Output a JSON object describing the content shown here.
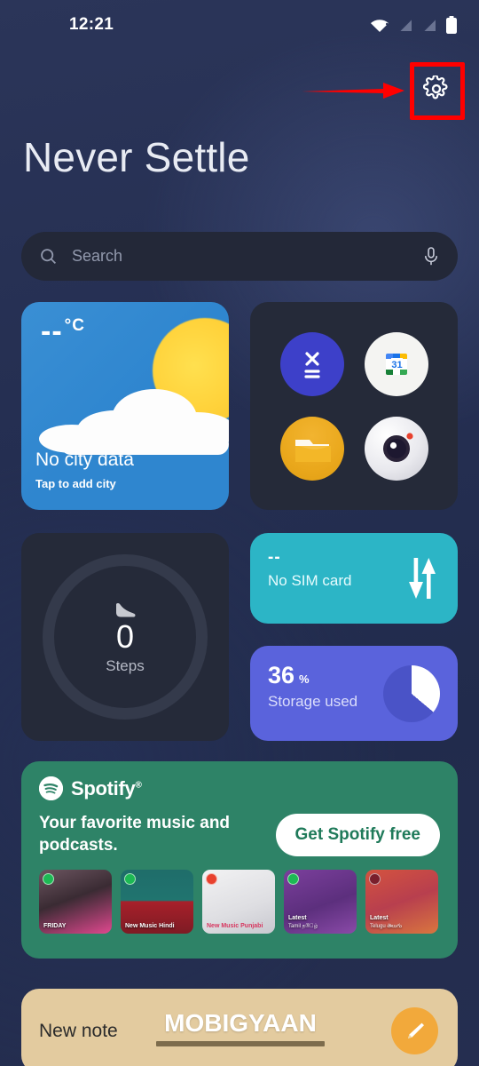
{
  "status_bar": {
    "time": "12:21",
    "icons": [
      "wifi-icon",
      "signal-off-icon",
      "signal-off-icon",
      "battery-icon"
    ]
  },
  "annotation": {
    "highlight_color": "#ff0000",
    "arrow_color": "#ff0000",
    "target": "settings-gear-button"
  },
  "header": {
    "gear_icon": "gear-icon",
    "title": "Never Settle"
  },
  "search": {
    "placeholder": "Search",
    "search_icon": "search-icon",
    "mic_icon": "microphone-icon",
    "background": "#232838"
  },
  "weather_widget": {
    "temperature": "--",
    "unit": "°C",
    "city": "No city data",
    "action": "Tap to add city",
    "background": "#2f86cf"
  },
  "app_folder": {
    "background": "#252a39",
    "apps": [
      {
        "name": "calculator",
        "icon": "calculator-icon",
        "color": "#3d40c9"
      },
      {
        "name": "calendar",
        "icon": "calendar-icon",
        "date": "31",
        "color": "#f4f4f2"
      },
      {
        "name": "files",
        "icon": "folder-icon",
        "color": "#eaa81c"
      },
      {
        "name": "camera",
        "icon": "camera-icon",
        "color": "#e9e9ee"
      }
    ]
  },
  "steps_widget": {
    "icon": "shoe-icon",
    "count": "0",
    "label": "Steps",
    "background": "#252a39",
    "ring_color": "#343a4b"
  },
  "sim_widget": {
    "value": "--",
    "label": "No SIM card",
    "icon": "data-transfer-icon",
    "background": "#2cb5c6"
  },
  "storage_widget": {
    "value": "36",
    "percent_symbol": "%",
    "label": "Storage used",
    "background": "#5a63dc",
    "chart_used_pct": 36
  },
  "spotify_card": {
    "brand": "Spotify",
    "trademark": "®",
    "tagline": "Your favorite music and podcasts.",
    "cta_label": "Get Spotify free",
    "background": "#2e8367",
    "thumbnails": [
      {
        "title": "FRIDAY",
        "subtitle": "",
        "color": "#b8446f"
      },
      {
        "title": "New Music Hindi",
        "subtitle": "",
        "color": "#1f6d6a"
      },
      {
        "title": "New Music Punjabi",
        "subtitle": "",
        "color": "#e8e8ea"
      },
      {
        "title": "Latest",
        "subtitle": "Tamil த®ிழ்",
        "color": "#6f3a8f"
      },
      {
        "title": "Latest",
        "subtitle": "Telugu తెలుగు",
        "color": "#c96a3d"
      }
    ]
  },
  "note_widget": {
    "label": "New note",
    "pencil_icon": "pencil-icon",
    "background": "#e3cb9f",
    "button_color": "#f2a93b"
  },
  "watermark": {
    "text": "MOBIGYAAN"
  }
}
